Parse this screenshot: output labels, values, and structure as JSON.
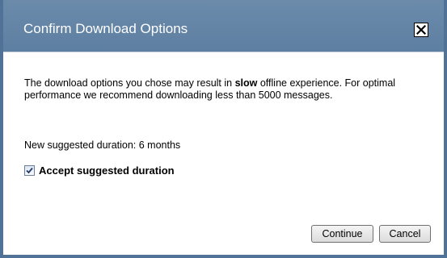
{
  "dialog": {
    "title": "Confirm Download Options",
    "message_before": "The download options you chose may result in ",
    "message_bold": "slow",
    "message_after": " offline experience. For optimal performance we recommend downloading less than 5000 messages.",
    "suggested_label": "New suggested duration: 6 months",
    "accept_checkbox": {
      "label": "Accept suggested duration",
      "checked": true
    },
    "buttons": {
      "continue_label": "Continue",
      "cancel_label": "Cancel"
    }
  },
  "colors": {
    "titlebar": "#5d7fa1",
    "border": "#4f7296",
    "title_text": "#ffffff"
  },
  "icons": {
    "close": "close-icon",
    "check": "checkmark-icon"
  }
}
